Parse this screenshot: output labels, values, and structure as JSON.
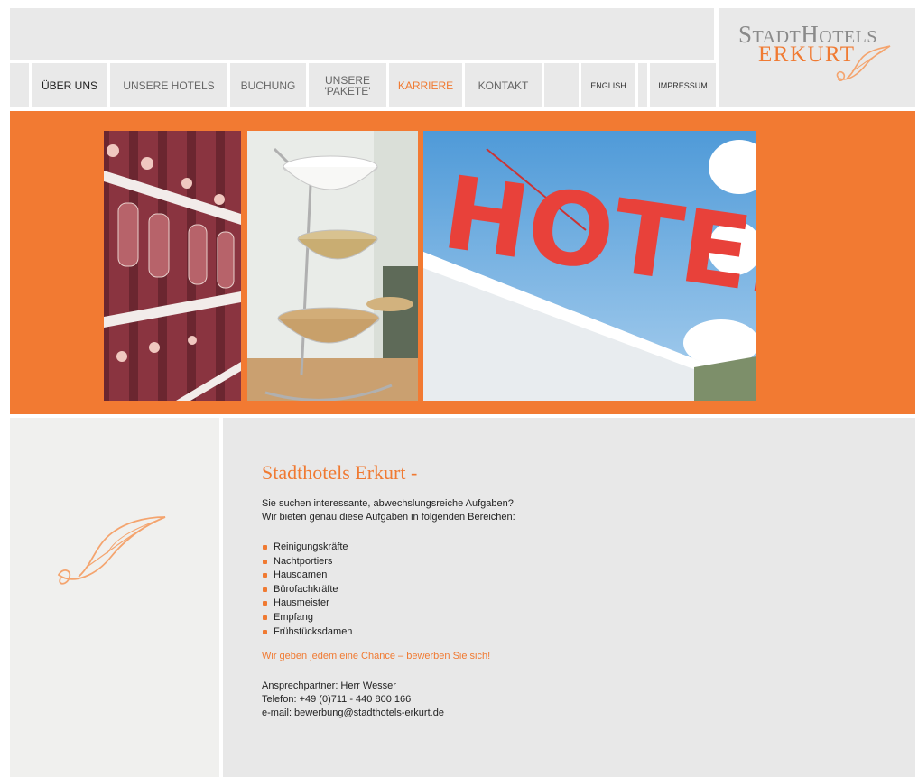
{
  "brand": {
    "logo_line1_big1": "S",
    "logo_line1_small1": "TADT",
    "logo_line1_big2": "H",
    "logo_line1_small2": "OTELS",
    "logo_line2": "ERKURT"
  },
  "nav": {
    "items": [
      {
        "label": "ÜBER UNS"
      },
      {
        "label": "UNSERE HOTELS"
      },
      {
        "label": "BUCHUNG"
      },
      {
        "label1": "UNSERE",
        "label2": "'PAKETE'"
      },
      {
        "label": "KARRIERE"
      },
      {
        "label": "KONTAKT"
      },
      {
        "label": "ENGLISH"
      },
      {
        "label": "IMPRESSUM"
      }
    ]
  },
  "banner": {
    "hotel_sign_text": "HOTEL"
  },
  "content": {
    "headline": "Stadthotels Erkurt -",
    "intro_line1": "Sie suchen interessante, abwechslungsreiche Aufgaben?",
    "intro_line2": "Wir bieten genau diese Aufgaben in folgenden Bereichen:",
    "jobs": [
      "Reinigungskräfte",
      "Nachtportiers",
      "Hausdamen",
      "Bürofachkräfte",
      "Hausmeister",
      "Empfang",
      "Frühstücksdamen"
    ],
    "cta": "Wir geben jedem eine Chance – bewerben Sie sich!",
    "contact_person": "Ansprechpartner: Herr Wesser",
    "phone": "Telefon: +49 (0)711 - 440 800 166",
    "email": "e-mail: bewerbung@stadthotels-erkurt.de"
  },
  "colors": {
    "accent": "#f27a32",
    "panel": "#e9e9e9"
  }
}
